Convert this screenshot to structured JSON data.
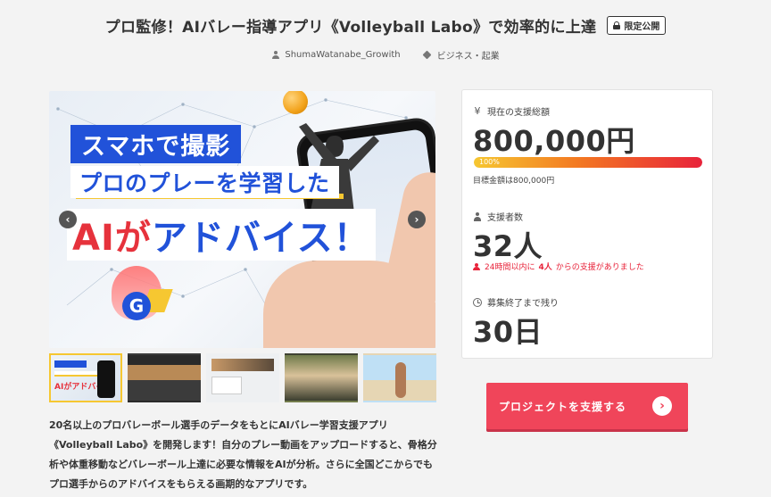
{
  "header": {
    "title": "プロ監修！AIバレー指導アプリ《Volleyball Labo》で効率的に上達",
    "badge": "限定公開"
  },
  "meta": {
    "author": "ShumaWatanabe_Growith",
    "category": "ビジネス・起業"
  },
  "hero": {
    "caption_line1": "スマホで撮影",
    "caption_line2": "プロのプレーを学習した",
    "caption_line3_a": "AIが",
    "caption_line3_b": "アドバイス！",
    "logo_letter": "G",
    "prev_label": "‹",
    "next_label": "›"
  },
  "thumbnails": [
    {
      "mini_caption": "AIがアドバイス",
      "active": true
    },
    {
      "active": false
    },
    {
      "active": false
    },
    {
      "active": false
    },
    {
      "active": false
    }
  ],
  "description": "20名以上のプロバレーボール選手のデータをもとにAIバレー学習支援アプリ《Volleyball Labo》を開発します！自分のプレー動画をアップロードすると、骨格分析や体重移動などバレーボール上達に必要な情報をAIが分析。さらに全国どこからでもプロ選手からのアドバイスをもらえる画期的なアプリです。",
  "stats": {
    "funding_label": "現在の支援総額",
    "funding_value": "800,000円",
    "progress_percent": 100,
    "progress_text": "100%",
    "goal_text": "目標金額は800,000円",
    "supporters_label": "支援者数",
    "supporters_value": "32人",
    "recent_prefix": "24時間以内に",
    "recent_count": "4人",
    "recent_suffix": "からの支援がありました",
    "remaining_label": "募集終了まで残り",
    "remaining_value": "30日"
  },
  "cta": {
    "label": "プロジェクトを支援する"
  },
  "colors": {
    "accent": "#f0455a",
    "brand_blue": "#2152d9",
    "highlight_yellow": "#f6c731"
  }
}
